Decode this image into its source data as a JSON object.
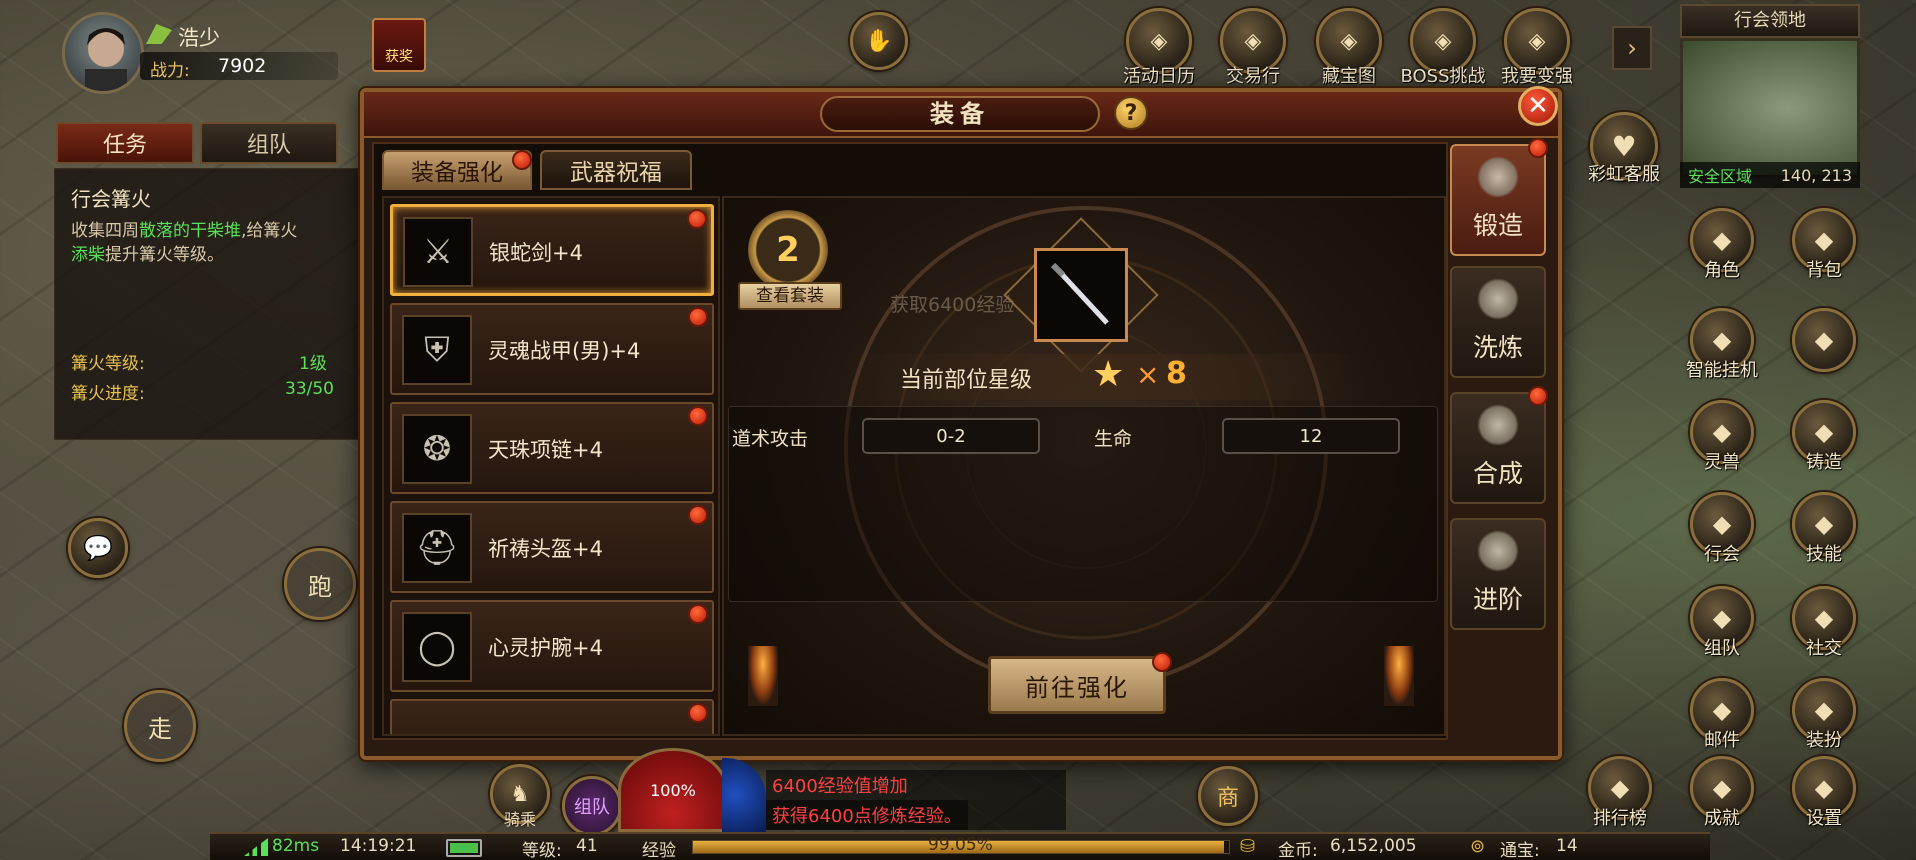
{
  "player": {
    "name": "浩少",
    "power_label": "战力:",
    "power_value": "7902"
  },
  "top_status_label": "获奖",
  "top_menu": [
    {
      "label": "活动日历",
      "icon": "calendar-icon"
    },
    {
      "label": "交易行",
      "icon": "scales-icon"
    },
    {
      "label": "藏宝图",
      "icon": "treasure-map-icon"
    },
    {
      "label": "BOSS挑战",
      "icon": "boss-mask-icon"
    },
    {
      "label": "我要变强",
      "icon": "fist-icon"
    }
  ],
  "minimap": {
    "title": "行会领地",
    "zone": "安全区域",
    "coords": "140, 213"
  },
  "customer_service": "彩虹客服",
  "quest": {
    "tabs": [
      "任务",
      "组队"
    ],
    "title": "行会篝火",
    "desc_parts": [
      "收集四周",
      "散落的干柴堆",
      ",给篝火",
      "添柴",
      "提升篝火等级。"
    ],
    "level_label": "篝火等级:",
    "level_value": "1级",
    "progress_label": "篝火进度:",
    "progress_value": "33/50"
  },
  "dialog": {
    "title": "装备",
    "help": "?",
    "close": "✕",
    "tabs": [
      "装备强化",
      "武器祝福"
    ],
    "equipment": [
      {
        "name": "银蛇剑+4",
        "icon": "sword-icon",
        "selected": true
      },
      {
        "name": "灵魂战甲(男)+4",
        "icon": "armor-icon"
      },
      {
        "name": "天珠项链+4",
        "icon": "necklace-icon"
      },
      {
        "name": "祈祷头盔+4",
        "icon": "helmet-icon"
      },
      {
        "name": "心灵护腕+4",
        "icon": "bracer-icon"
      }
    ],
    "set_count": "2",
    "set_label": "查看套装",
    "faded_text": "获取6400经验",
    "star_label": "当前部位星级",
    "star_mult": "×",
    "star_value": "8",
    "stats": [
      {
        "label": "道术攻击",
        "value": "0-2"
      },
      {
        "label": "生命",
        "value": "12"
      }
    ],
    "go_button": "前往强化",
    "side_tabs": [
      "锻造",
      "洗炼",
      "合成",
      "进阶"
    ]
  },
  "right_menu": [
    {
      "label": "角色",
      "icon": "character-icon"
    },
    {
      "label": "背包",
      "icon": "bag-icon"
    },
    {
      "label": "智能挂机",
      "icon": "auto-icon"
    },
    {
      "label": "",
      "icon": "cross-swords-icon"
    },
    {
      "label": "灵兽",
      "icon": "beast-icon"
    },
    {
      "label": "铸造",
      "icon": "anvil-icon"
    },
    {
      "label": "行会",
      "icon": "guild-icon"
    },
    {
      "label": "技能",
      "icon": "scroll-icon"
    },
    {
      "label": "组队",
      "icon": "team-icon"
    },
    {
      "label": "社交",
      "icon": "handshake-icon"
    },
    {
      "label": "邮件",
      "icon": "mail-icon"
    },
    {
      "label": "装扮",
      "icon": "outfit-icon"
    },
    {
      "label": "排行榜",
      "icon": "ranking-icon"
    },
    {
      "label": "成就",
      "icon": "trophy-icon"
    },
    {
      "label": "设置",
      "icon": "gear-icon"
    }
  ],
  "left_controls": {
    "run": "跑",
    "walk": "走",
    "mount": "骑乘",
    "team": "组队",
    "hp": "100%",
    "shop": "商"
  },
  "messages": [
    "6400经验值增加",
    "获得6400点修炼经验。"
  ],
  "status": {
    "ping": "82ms",
    "time": "14:19:21",
    "level_label": "等级:",
    "level": "41",
    "exp_label": "经验",
    "exp_value": "99.05%",
    "exp_fraction": 0.9905,
    "gold_label": "金币:",
    "gold": "6,152,005",
    "ingot_label": "通宝:",
    "ingot": "14"
  }
}
